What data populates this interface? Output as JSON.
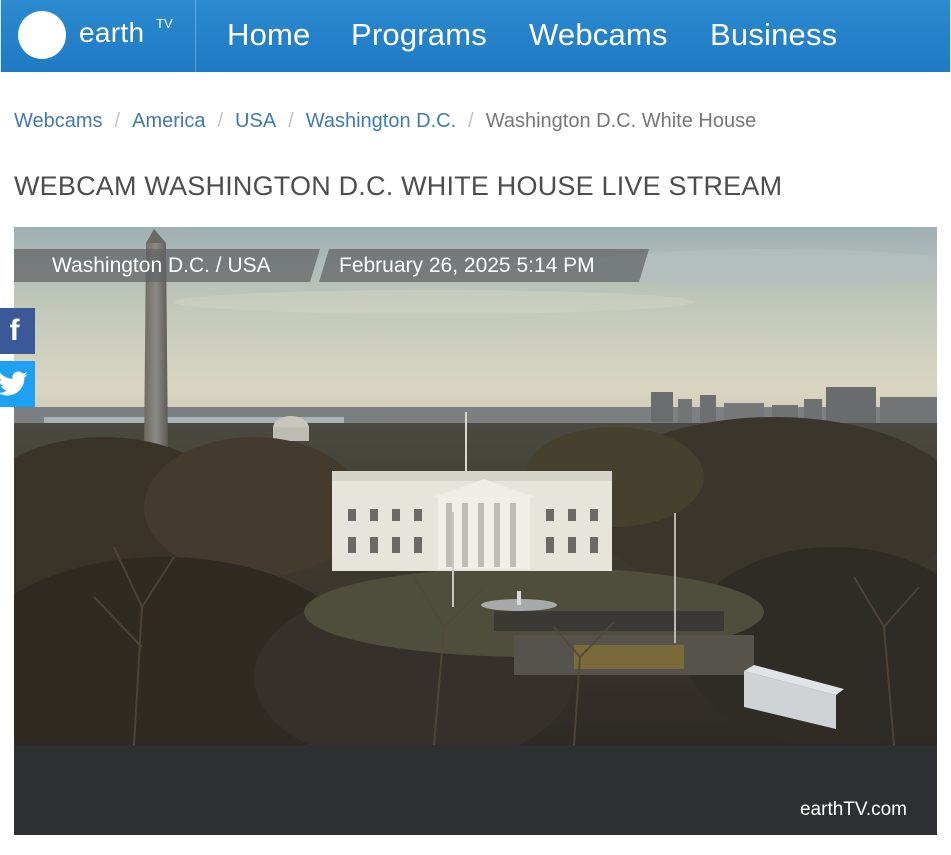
{
  "header": {
    "brand": {
      "word": "earth",
      "superscript": "TV"
    },
    "nav": [
      {
        "label": "Home"
      },
      {
        "label": "Programs"
      },
      {
        "label": "Webcams"
      },
      {
        "label": "Business"
      }
    ]
  },
  "breadcrumb": {
    "items": [
      {
        "label": "Webcams"
      },
      {
        "label": "America"
      },
      {
        "label": "USA"
      },
      {
        "label": "Washington D.C."
      }
    ],
    "separator": "/",
    "current": "Washington D.C. White House"
  },
  "page": {
    "title": "WEBCAM WASHINGTON D.C. WHITE HOUSE LIVE STREAM"
  },
  "player": {
    "location": "Washington D.C. / USA",
    "datetime": "February 26, 2025 5:14 PM",
    "brand": "earthTV.com"
  },
  "social": {
    "facebook_icon": "facebook-icon",
    "twitter_icon": "twitter-icon"
  },
  "colors": {
    "header_blue": "#2283c8",
    "link_blue": "#3d7ab6",
    "facebook_blue": "#3b5998",
    "twitter_blue": "#1da1f2",
    "player_bar": "#2e2f31"
  }
}
